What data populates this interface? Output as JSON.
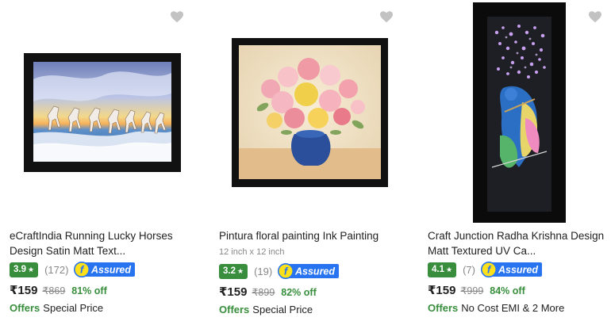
{
  "products": [
    {
      "title_line1": "eCraftIndia Running Lucky Horses",
      "title_line2": "Design Satin Matt Text...",
      "subtitle": "",
      "rating": "3.9",
      "rating_count": "(172)",
      "assured_label": "Assured",
      "price": "₹159",
      "mrp": "₹869",
      "discount": "81% off",
      "offers_label": "Offers",
      "offer_text": "Special Price"
    },
    {
      "title_line1": "Pintura floral painting Ink Painting",
      "title_line2": "",
      "subtitle": "12 inch x 12 inch",
      "rating": "3.2",
      "rating_count": "(19)",
      "assured_label": "Assured",
      "price": "₹159",
      "mrp": "₹899",
      "discount": "82% off",
      "offers_label": "Offers",
      "offer_text": "Special Price"
    },
    {
      "title_line1": "Craft Junction Radha Krishna Design",
      "title_line2": "Matt Textured UV Ca...",
      "subtitle": "",
      "rating": "4.1",
      "rating_count": "(7)",
      "assured_label": "Assured",
      "price": "₹159",
      "mrp": "₹999",
      "discount": "84% off",
      "offers_label": "Offers",
      "offer_text": "No Cost EMI & 2 More"
    }
  ],
  "icons": {
    "wishlist": "heart-icon",
    "rating_star": "star-icon",
    "assured": "flipkart-assured-badge"
  },
  "colors": {
    "rating_green": "#388e3c",
    "assured_blue": "#2874f0",
    "assured_yellow": "#ffe11b",
    "muted_gray": "#878787",
    "heart_gray": "#c2c2c2"
  }
}
